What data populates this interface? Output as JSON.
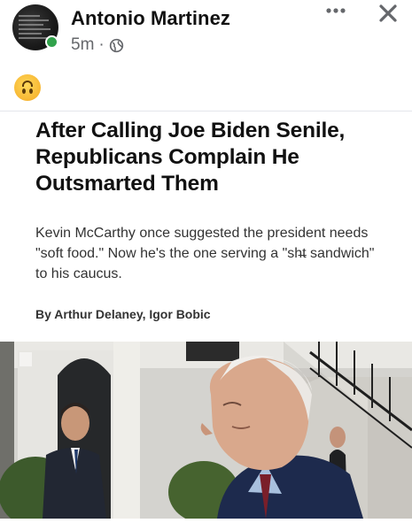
{
  "post": {
    "author": "Antonio Martinez",
    "time": "5m",
    "separator": "·",
    "emoji": "🙃"
  },
  "icons": {
    "more": "more-dots-icon",
    "close": "close-icon",
    "audience": "globe-icon",
    "online": "online-status-icon"
  },
  "article": {
    "headline": "After Calling Joe Biden Senile, Republicans Complain He Outsmarted Them",
    "deck": "Kevin McCarthy once suggested the president needs \"soft food.\" Now he's the one serving a \"sh̶t sandwich\" to his caucus.",
    "byline": "By Arthur Delaney, Igor Bobic"
  },
  "colors": {
    "online": "#31a24c",
    "meta_gray": "#65676b",
    "text": "#050505"
  }
}
